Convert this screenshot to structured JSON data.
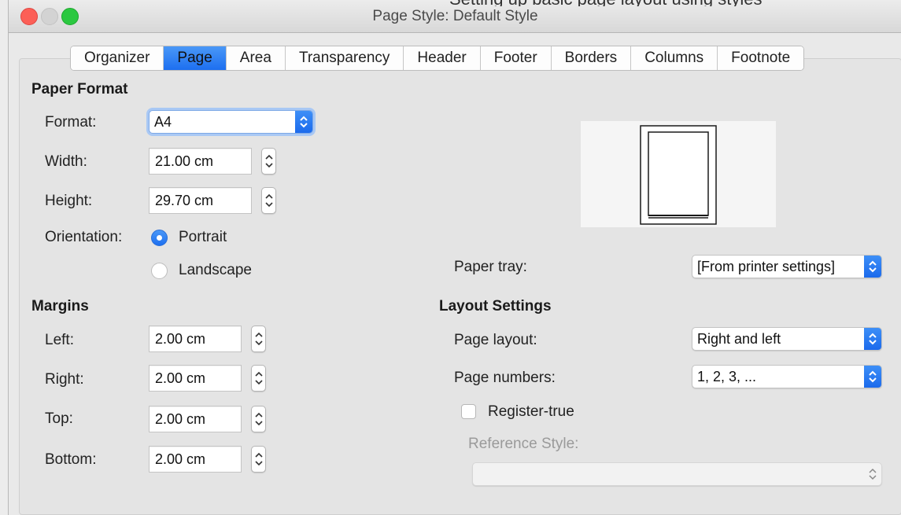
{
  "window": {
    "title": "Page Style: Default Style",
    "background_text": "Setting up basic page layout using styles"
  },
  "tabs": [
    {
      "label": "Organizer",
      "active": false
    },
    {
      "label": "Page",
      "active": true
    },
    {
      "label": "Area",
      "active": false
    },
    {
      "label": "Transparency",
      "active": false
    },
    {
      "label": "Header",
      "active": false
    },
    {
      "label": "Footer",
      "active": false
    },
    {
      "label": "Borders",
      "active": false
    },
    {
      "label": "Columns",
      "active": false
    },
    {
      "label": "Footnote",
      "active": false
    }
  ],
  "paper_format": {
    "heading": "Paper Format",
    "format_label": "Format:",
    "format_value": "A4",
    "width_label": "Width:",
    "width_value": "21.00 cm",
    "height_label": "Height:",
    "height_value": "29.70 cm",
    "orientation_label": "Orientation:",
    "portrait_label": "Portrait",
    "landscape_label": "Landscape",
    "orientation_selected": "Portrait",
    "paper_tray_label": "Paper tray:",
    "paper_tray_value": "[From printer settings]"
  },
  "margins": {
    "heading": "Margins",
    "left_label": "Left:",
    "left_value": "2.00 cm",
    "right_label": "Right:",
    "right_value": "2.00 cm",
    "top_label": "Top:",
    "top_value": "2.00 cm",
    "bottom_label": "Bottom:",
    "bottom_value": "2.00 cm"
  },
  "layout_settings": {
    "heading": "Layout Settings",
    "page_layout_label": "Page layout:",
    "page_layout_value": "Right and left",
    "page_numbers_label": "Page numbers:",
    "page_numbers_value": "1, 2, 3, ...",
    "register_true_label": "Register-true",
    "register_true_checked": false,
    "reference_style_label": "Reference Style:",
    "reference_style_value": ""
  },
  "colors": {
    "accent": "#1d6ff0",
    "close": "#fc5f57",
    "maximize": "#2bc840"
  }
}
